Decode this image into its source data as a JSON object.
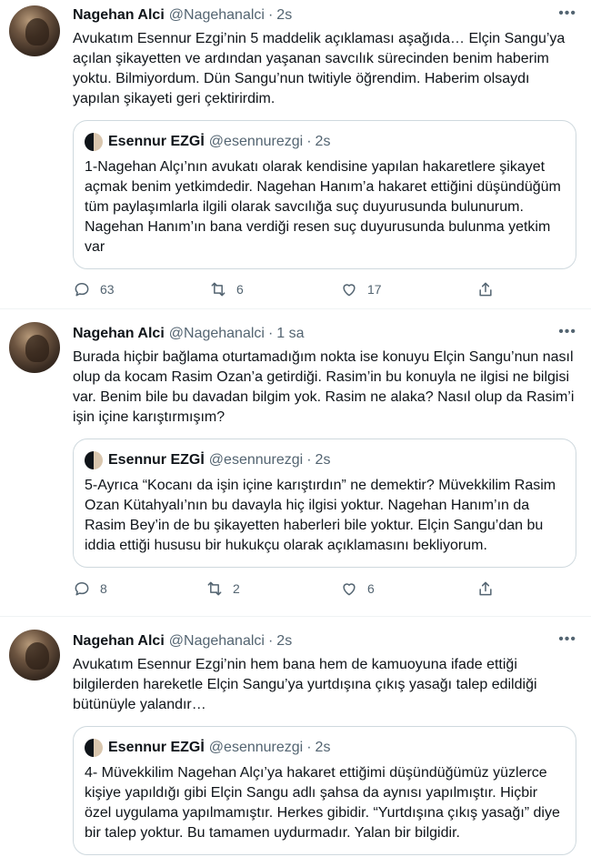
{
  "tweets": [
    {
      "name": "Nagehan Alci",
      "handle": "@Nagehanalci",
      "time": "2s",
      "text": "Avukatım Esennur Ezgi’nin 5 maddelik açıklaması aşağıda… Elçin Sangu’ya açılan şikayetten ve ardından yaşanan savcılık sürecinden benim haberim yoktu. Bilmiyordum. Dün Sangu’nun twitiyle öğrendim. Haberim olsaydı yapılan şikayeti geri çektirirdim.",
      "quote": {
        "name": "Esennur EZGİ",
        "handle": "@esennurezgi",
        "time": "2s",
        "text": "1-Nagehan Alçı’nın avukatı olarak kendisine yapılan hakaretlere şikayet açmak benim yetkimdedir. Nagehan Hanım’a hakaret ettiğini düşündüğüm tüm paylaşımlarla ilgili olarak savcılığa suç duyurusunda bulunurum. Nagehan Hanım’ın bana verdiği resen suç duyurusunda bulunma yetkim var"
      },
      "replies": "63",
      "retweets": "6",
      "likes": "17"
    },
    {
      "name": "Nagehan Alci",
      "handle": "@Nagehanalci",
      "time": "1 sa",
      "text": "Burada hiçbir bağlama oturtamadığım nokta ise konuyu Elçin Sangu’nun nasıl olup da kocam Rasim Ozan’a getirdiği. Rasim’in bu konuyla ne ilgisi ne bilgisi var. Benim bile bu davadan bilgim yok. Rasim ne alaka? Nasıl olup da Rasim’i işin içine karıştırmışım?",
      "quote": {
        "name": "Esennur EZGİ",
        "handle": "@esennurezgi",
        "time": "2s",
        "text": "5-Ayrıca “Kocanı da işin içine karıştırdın” ne demektir? Müvekkilim Rasim Ozan Kütahyalı’nın bu davayla hiç ilgisi yoktur. Nagehan Hanım’ın da Rasim Bey’in de bu şikayetten haberleri bile yoktur. Elçin Sangu’dan bu iddia ettiği hususu bir hukukçu olarak açıklamasını bekliyorum."
      },
      "replies": "8",
      "retweets": "2",
      "likes": "6"
    },
    {
      "name": "Nagehan Alci",
      "handle": "@Nagehanalci",
      "time": "2s",
      "text": "Avukatım Esennur Ezgi’nin hem bana hem de kamuoyuna ifade ettiği bilgilerden hareketle Elçin Sangu’ya yurtdışına çıkış yasağı talep edildiği bütünüyle yalandır…",
      "quote": {
        "name": "Esennur EZGİ",
        "handle": "@esennurezgi",
        "time": "2s",
        "text": "4- Müvekkilim Nagehan Alçı’ya hakaret ettiğimi düşündüğümüz yüzlerce kişiye yapıldığı gibi Elçin Sangu adlı şahsa da aynısı yapılmıştır. Hiçbir özel uygulama yapılmamıştır. Herkes gibidir. “Yurtdışına çıkış yasağı” diye bir talep yoktur. Bu tamamen uydurmadır. Yalan bir bilgidir."
      }
    }
  ],
  "ui": {
    "dot": "·",
    "more": "•••",
    "accent": "#1d9bf0",
    "icons": [
      "reply-icon",
      "retweet-icon",
      "like-icon",
      "share-icon",
      "more-icon"
    ]
  }
}
